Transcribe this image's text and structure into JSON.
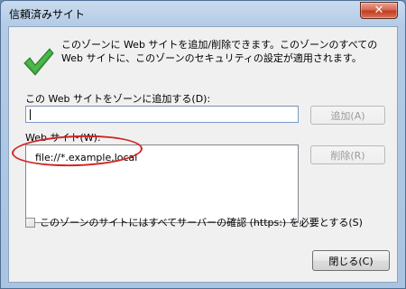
{
  "window": {
    "title": "信頼済みサイト",
    "close_glyph": "✕"
  },
  "info": {
    "text": "このゾーンに Web サイトを追加/削除できます。このゾーンのすべての Web サイトに、このゾーンのセキュリティの設定が適用されます。",
    "icon": "checkmark-icon",
    "icon_color": "#3aa63a"
  },
  "add_site": {
    "label": "この Web サイトをゾーンに追加する(D):",
    "input_value": "",
    "add_button": "追加(A)"
  },
  "sites": {
    "label": "Web サイト(W):",
    "items": [
      "file://*.example.local"
    ],
    "remove_button": "削除(R)",
    "highlight_color": "#d0231f"
  },
  "https_checkbox": {
    "label": "このゾーンのサイトにはすべてサーバーの確認 (https:) を必要とする(S)",
    "checked": false
  },
  "footer": {
    "close_button": "閉じる(C)"
  }
}
